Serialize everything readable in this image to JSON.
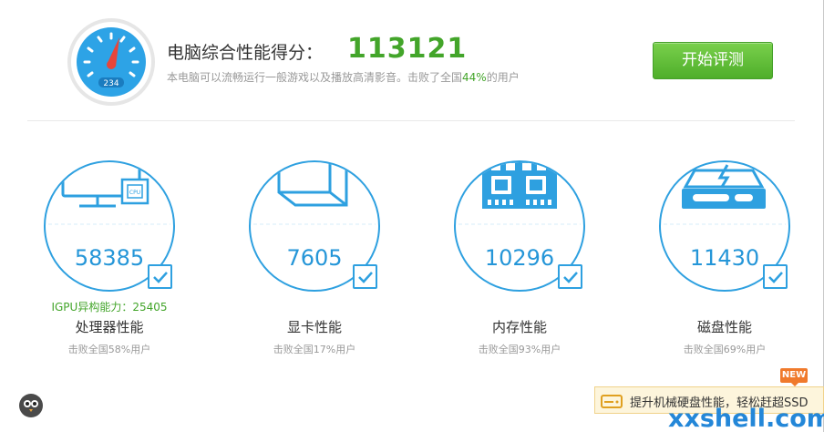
{
  "header": {
    "title": "电脑综合性能得分：",
    "score": "113121",
    "subtitle_prefix": "本电脑可以流畅运行一般游戏以及播放高清影音。击败了全国",
    "subtitle_percent": "44%",
    "subtitle_suffix": "的用户",
    "gauge_display": "234",
    "start_button_label": "开始评测"
  },
  "cards": [
    {
      "icon": "monitor-cpu-icon",
      "score": "58385",
      "extra": "IGPU异构能力：25405",
      "name": "处理器性能",
      "beat": "击败全国58%用户"
    },
    {
      "icon": "graphics-card-icon",
      "score": "7605",
      "name": "显卡性能",
      "beat": "击败全国17%用户"
    },
    {
      "icon": "memory-chip-icon",
      "score": "10296",
      "name": "内存性能",
      "beat": "击败全国93%用户"
    },
    {
      "icon": "hard-disk-icon",
      "score": "11430",
      "name": "磁盘性能",
      "beat": "击败全国69%用户"
    }
  ],
  "footer": {
    "badge": "NEW",
    "banner_text": "提升机械硬盘性能，轻松赶超SSD",
    "banner_icon": "hdd-upgrade-icon",
    "owl_icon": "owl-logo-icon",
    "watermark": "xxshell.com"
  },
  "colors": {
    "accent_green": "#43a52a",
    "accent_blue": "#2596d8",
    "button_green": "#5cb83a",
    "badge_orange": "#f07a2c"
  }
}
